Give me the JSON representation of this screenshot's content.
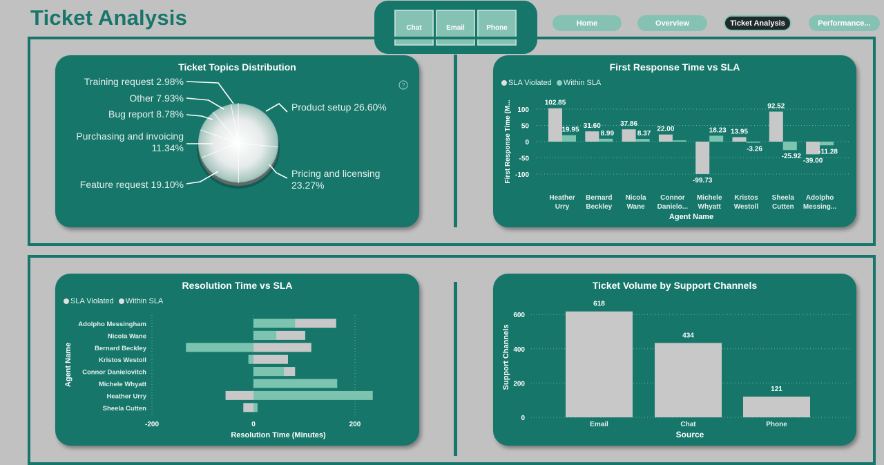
{
  "page": {
    "title": "Ticket Analysis"
  },
  "channels": {
    "chat": "Chat",
    "email": "Email",
    "phone": "Phone"
  },
  "nav": {
    "home": "Home",
    "overview": "Overview",
    "ticket_analysis": "Ticket Analysis",
    "performance": "Performance..."
  },
  "colors": {
    "teal": "#16766a",
    "bar_light": "#c8c8c8",
    "bar_teal": "#7cc4b0",
    "bg": "#c1c1c1"
  },
  "pie_card": {
    "title": "Ticket Topics Distribution",
    "help_icon": "question-circle-icon"
  },
  "frt_card": {
    "title": "First Response Time vs SLA",
    "legend": [
      "SLA Violated",
      "Within SLA"
    ]
  },
  "res_card": {
    "title": "Resolution Time vs SLA",
    "legend": [
      "SLA Violated",
      "Within SLA"
    ]
  },
  "vol_card": {
    "title": "Ticket Volume by Support Channels"
  },
  "chart_data": [
    {
      "type": "pie",
      "title": "Ticket Topics Distribution",
      "slices": [
        {
          "label": "Product setup",
          "value": 26.6,
          "text": "Product setup 26.60%"
        },
        {
          "label": "Pricing and licensing",
          "value": 23.27,
          "text": [
            "Pricing and licensing",
            "23.27%"
          ]
        },
        {
          "label": "Feature request",
          "value": 19.1,
          "text": "Feature request 19.10%"
        },
        {
          "label": "Purchasing and invoicing",
          "value": 11.34,
          "text": [
            "Purchasing and invoicing",
            "11.34%"
          ]
        },
        {
          "label": "Bug report",
          "value": 8.78,
          "text": "Bug report 8.78%"
        },
        {
          "label": "Other",
          "value": 7.93,
          "text": "Other 7.93%"
        },
        {
          "label": "Training request",
          "value": 2.98,
          "text": "Training request 2.98%"
        }
      ]
    },
    {
      "type": "bar",
      "title": "First Response Time vs SLA",
      "xlabel": "Agent Name",
      "ylabel": "First Response Time (M...",
      "categories": [
        [
          "Heather",
          "Urry"
        ],
        [
          "Bernard",
          "Beckley"
        ],
        [
          "Nicola",
          "Wane"
        ],
        [
          "Connor",
          "Danielo..."
        ],
        [
          "Michele",
          "Whyatt"
        ],
        [
          "Kristos",
          "Westoll"
        ],
        [
          "Sheela",
          "Cutten"
        ],
        [
          "Adolpho",
          "Messing..."
        ]
      ],
      "series": [
        {
          "name": "SLA Violated",
          "values": [
            102.85,
            31.6,
            37.86,
            22.0,
            -99.73,
            13.95,
            92.52,
            -39.0
          ]
        },
        {
          "name": "Within SLA",
          "values": [
            19.95,
            8.99,
            8.37,
            4.0,
            18.23,
            -3.26,
            -25.92,
            -11.28
          ]
        }
      ],
      "data_labels": [
        [
          "102.85",
          "19.95"
        ],
        [
          "31.60",
          "8.99"
        ],
        [
          "37.86",
          "8.37"
        ],
        [
          "22.00",
          ""
        ],
        [
          "-99.73",
          "18.23"
        ],
        [
          "13.95",
          "-3.26"
        ],
        [
          "92.52",
          "-25.92"
        ],
        [
          "-39.00",
          "-11.28"
        ]
      ],
      "yticks": [
        100,
        50,
        0,
        -50,
        -100
      ],
      "ylim": [
        -120,
        120
      ]
    },
    {
      "type": "bar",
      "orientation": "horizontal",
      "title": "Resolution Time vs SLA",
      "xlabel": "Resolution Time (Minutes)",
      "ylabel": "Agent Name",
      "categories": [
        "Adolpho Messingham",
        "Nicola Wane",
        "Bernard Beckley",
        "Kristos Westoll",
        "Connor Danielovitch",
        "Michele Whyatt",
        "Heather Urry",
        "Sheela Cutten"
      ],
      "series": [
        {
          "name": "SLA Violated",
          "values": [
            163,
            102,
            114,
            68,
            82,
            157,
            -55,
            -20
          ]
        },
        {
          "name": "Within SLA",
          "values": [
            82,
            45,
            -133,
            -10,
            60,
            165,
            235,
            8
          ]
        }
      ],
      "xticks": [
        -200,
        0,
        200
      ],
      "xlim": [
        -230,
        250
      ]
    },
    {
      "type": "bar",
      "title": "Ticket Volume by Support Channels",
      "xlabel": "Source",
      "ylabel": "Support Channels",
      "categories": [
        "Email",
        "Chat",
        "Phone"
      ],
      "values": [
        618,
        434,
        121
      ],
      "yticks": [
        600,
        400,
        200,
        0
      ],
      "ylim": [
        0,
        660
      ]
    }
  ]
}
